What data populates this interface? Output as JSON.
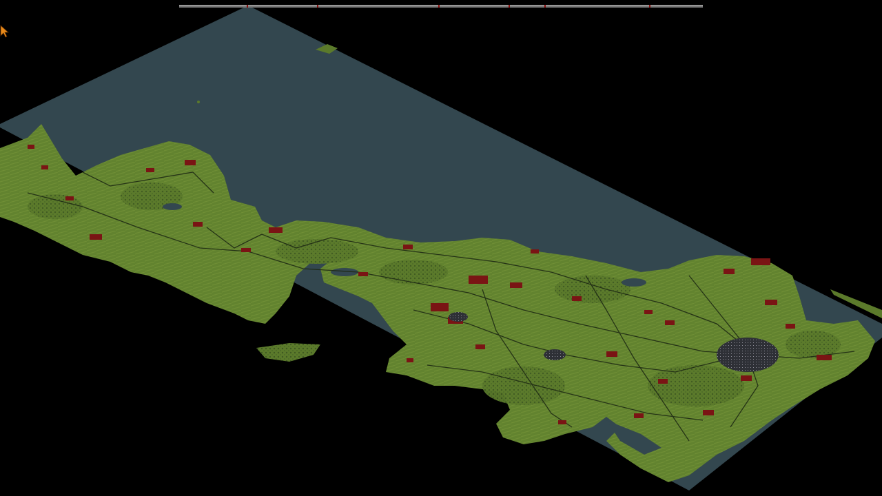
{
  "colors": {
    "background": "#000000",
    "sea": "#33474f",
    "land": "#5b7a2b",
    "land_light": "#6f8e35",
    "forest": "#3f5a22",
    "town": "#7a1414",
    "road": "#1e2a14",
    "city_dense": "#3a3a44",
    "cursor": "#e88a1a"
  },
  "icons": {
    "cursor": "arrow-pointer-icon"
  }
}
